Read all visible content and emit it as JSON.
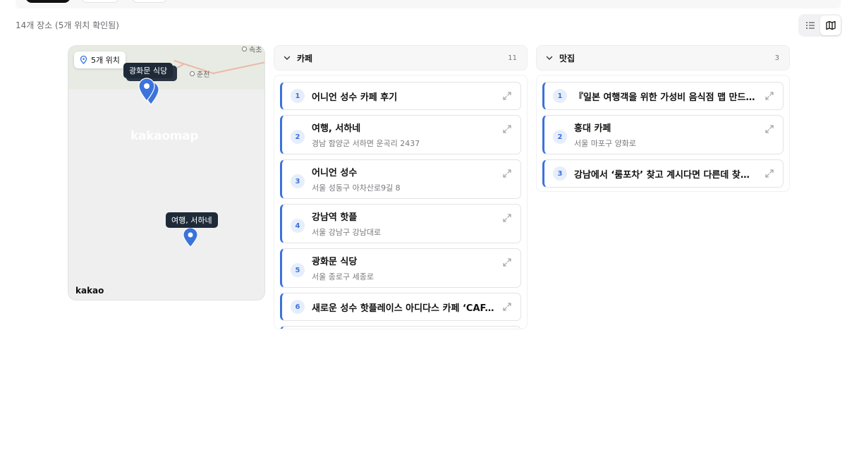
{
  "summary": "14개 장소 (5개 위치 확인됨)",
  "view_toggle": {
    "list_icon": "list-icon",
    "map_icon": "map-icon",
    "active": "map"
  },
  "map": {
    "location_badge": "5개 위치",
    "cities": [
      "속초",
      "춘천"
    ],
    "watermark": "kakaomap",
    "logo": "kakao",
    "tooltips": [
      "광화문 식당",
      "여행, 서하네"
    ],
    "pin_color": "#3b73db"
  },
  "columns": [
    {
      "title": "카페",
      "count": "11",
      "items": [
        {
          "num": "1",
          "name": "어니언 성수 카페 후기",
          "address": ""
        },
        {
          "num": "2",
          "name": "여행, 서하네",
          "address": "경남 함양군 서하면 운곡리 2437"
        },
        {
          "num": "3",
          "name": "어니언 성수",
          "address": "서울 성동구 아차산로9길 8"
        },
        {
          "num": "4",
          "name": "강남역 핫플",
          "address": "서울 강남구 강남대로"
        },
        {
          "num": "5",
          "name": "광화문 식당",
          "address": "서울 종로구 세종로"
        },
        {
          "num": "6",
          "name": "새로운 성수 핫플레이스 아디다스 카페 ‘CAF...",
          "address": ""
        }
      ]
    },
    {
      "title": "맛집",
      "count": "3",
      "items": [
        {
          "num": "1",
          "name": "『일본 여행객을 위한 가성비 음식점 맵 만드는 ...",
          "address": ""
        },
        {
          "num": "2",
          "name": "홍대 카페",
          "address": "서울 마포구 양화로"
        },
        {
          "num": "3",
          "name": "강남에서 ‘룸포차’ 찾고 계시다면 다른데 찾지 ...",
          "address": ""
        }
      ]
    }
  ],
  "colors": {
    "accent": "#3b73db",
    "tooltip_bg": "#1e2a38"
  }
}
